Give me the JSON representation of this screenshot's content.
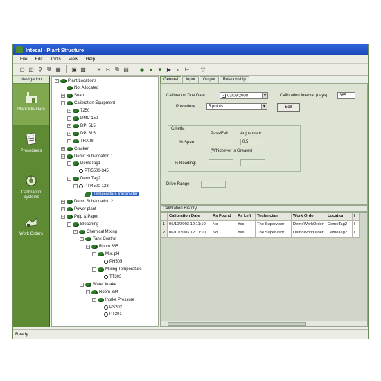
{
  "window": {
    "title": "Intecal - Plant Structure"
  },
  "menu": [
    "File",
    "Edit",
    "Tools",
    "View",
    "Help"
  ],
  "toolbar": {
    "icons": [
      "new-icon",
      "open-icon",
      "find-icon",
      "copy-icon",
      "print-preview-icon",
      "save-icon",
      "print-icon",
      "delete-icon",
      "cut-icon",
      "copy-icon",
      "paste-icon",
      "settings-icon",
      "export-icon",
      "import-icon",
      "run-icon",
      "forward-icon",
      "tree-icon",
      "filter-icon"
    ]
  },
  "nav": {
    "header": "Navigation",
    "items": [
      {
        "label": "Plant Structure",
        "icon": "plant-structure-icon"
      },
      {
        "label": "Procedures",
        "icon": "procedures-icon"
      },
      {
        "label": "Calibration Systems",
        "icon": "calibration-systems-icon"
      },
      {
        "label": "Work Orders",
        "icon": "work-orders-icon"
      }
    ]
  },
  "tree": [
    {
      "label": "Plant Locations",
      "icon": "green",
      "exp": "-"
    },
    {
      "label": "Not Allocated",
      "icon": "green",
      "exp": ""
    },
    {
      "label": "Soap",
      "icon": "green",
      "exp": "+"
    },
    {
      "label": "Calibration Equipment",
      "icon": "green",
      "exp": "-"
    },
    {
      "label": "7250",
      "icon": "green",
      "exp": "+"
    },
    {
      "label": "DMC 150",
      "icon": "green",
      "exp": "+"
    },
    {
      "label": "DPI 515",
      "icon": "green",
      "exp": "+"
    },
    {
      "label": "DPI 615",
      "icon": "green",
      "exp": "+"
    },
    {
      "label": "TRX III",
      "icon": "green",
      "exp": "+"
    },
    {
      "label": "Cracker",
      "icon": "green",
      "exp": "+"
    },
    {
      "label": "Demo Sub-location 1",
      "icon": "green",
      "exp": "-"
    },
    {
      "label": "DemoTag1",
      "icon": "green",
      "exp": "-"
    },
    {
      "label": "PT\\5500-345",
      "icon": "circle",
      "exp": ""
    },
    {
      "label": "DemoTag2",
      "icon": "green",
      "exp": "-"
    },
    {
      "label": "PT\\4500-123",
      "icon": "circle",
      "exp": "-"
    },
    {
      "label": "Temperature transmitter",
      "icon": "sel",
      "exp": ""
    },
    {
      "label": "Demo Sub-location 2",
      "icon": "green",
      "exp": "+"
    },
    {
      "label": "Power plant",
      "icon": "green",
      "exp": "+"
    },
    {
      "label": "Pulp & Paper",
      "icon": "green",
      "exp": "-"
    },
    {
      "label": "Bleaching",
      "icon": "green",
      "exp": "-"
    },
    {
      "label": "Chemical Mixing",
      "icon": "green",
      "exp": "-"
    },
    {
      "label": "Tank Control",
      "icon": "green",
      "exp": "-"
    },
    {
      "label": "Room 335",
      "icon": "green",
      "exp": "-"
    },
    {
      "label": "Mix. pH",
      "icon": "green",
      "exp": "-"
    },
    {
      "label": "PH505",
      "icon": "circle",
      "exp": ""
    },
    {
      "label": "Mixing Temperature",
      "icon": "green",
      "exp": "-"
    },
    {
      "label": "TT303",
      "icon": "circle",
      "exp": ""
    },
    {
      "label": "Water Intake",
      "icon": "green",
      "exp": "-"
    },
    {
      "label": "Room 334",
      "icon": "green",
      "exp": "-"
    },
    {
      "label": "Intake Pressure",
      "icon": "green",
      "exp": "-"
    },
    {
      "label": "PS202",
      "icon": "circle",
      "exp": ""
    },
    {
      "label": "PT201",
      "icon": "circle",
      "exp": ""
    }
  ],
  "tabs": [
    "General",
    "Input",
    "Output",
    "Relationship"
  ],
  "general": {
    "due_date_label": "Calibration Due Date",
    "due_date_value": "03/09/2008",
    "interval_label": "Calibration Interval (days)",
    "interval_value": "365",
    "procedure_label": "Procedure",
    "procedure_value": "5 points",
    "edit_button": "Edit",
    "criteria_label": "Criteria",
    "passfail_label": "Pass/Fail",
    "adjustment_label": "Adjustment",
    "span_label": "% Span:",
    "span_passfail": "",
    "span_adjustment": "0.5",
    "whichever_label": "(Whichever is Greater)",
    "reading_label": "% Reading:",
    "reading_passfail": "",
    "reading_adjustment": "",
    "drive_range_label": "Drive Range:",
    "drive_range_value": ""
  },
  "history": {
    "title": "Calibration History",
    "columns": [
      "",
      "Calibration Date",
      "As Found",
      "As Left",
      "Technician",
      "Work Order",
      "Location",
      "I"
    ],
    "rows": [
      [
        "1",
        "06/10/2003 12:11:10",
        "No",
        "Yes",
        "The Supervisor",
        "DemoWorkOrder",
        "DemoTag2",
        "I"
      ],
      [
        "2",
        "06/10/2003 12:11:10",
        "No",
        "Yes",
        "The Supervisor",
        "DemoWorkOrder",
        "DemoTag2",
        "I"
      ]
    ]
  },
  "status": "Ready"
}
